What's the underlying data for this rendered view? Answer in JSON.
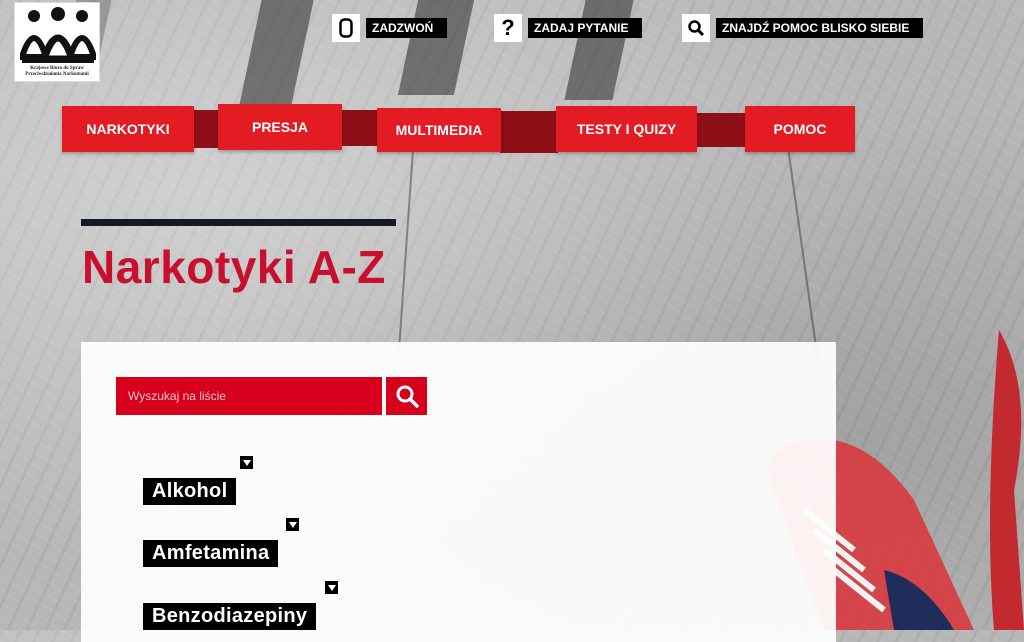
{
  "logo": {
    "text": "Krajowe Biuro do Spraw Przeciwdziałania Narkomanii"
  },
  "utility": [
    {
      "icon": "phone-icon",
      "label": "ZADZWOŃ"
    },
    {
      "icon": "question-icon",
      "label": "ZADAJ PYTANIE"
    },
    {
      "icon": "search-icon",
      "label": "ZNAJDŹ POMOC BLISKO SIEBIE"
    }
  ],
  "nav": [
    {
      "label": "NARKOTYKI"
    },
    {
      "label": "PRESJA"
    },
    {
      "label": "MULTIMEDIA"
    },
    {
      "label": "TESTY I QUIZY"
    },
    {
      "label": "POMOC"
    }
  ],
  "page": {
    "title": "Narkotyki A-Z"
  },
  "search": {
    "placeholder": "Wyszukaj na liście",
    "value": ""
  },
  "drugs": [
    {
      "name": "Alkohol"
    },
    {
      "name": "Amfetamina"
    },
    {
      "name": "Benzodiazepiny"
    }
  ],
  "colors": {
    "accent": "#e31b23",
    "accent_dark": "#8e1016",
    "title": "#c8102e"
  }
}
